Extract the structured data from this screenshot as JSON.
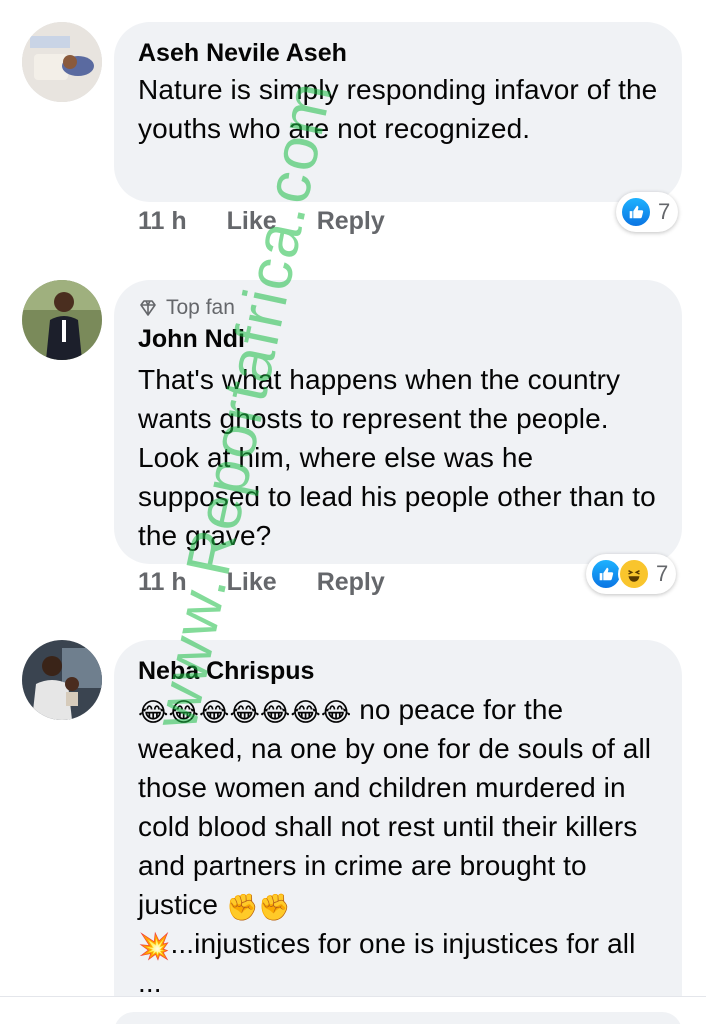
{
  "comments": [
    {
      "author": "Aseh Nevile Aseh",
      "badge": "",
      "text": "Nature is simply responding infavor of the youths who are not recognized.",
      "time": "11 h",
      "like_label": "Like",
      "reply_label": "Reply",
      "reactions": [
        "like"
      ],
      "reaction_count": "7"
    },
    {
      "author": "John Ndi",
      "badge": "Top fan",
      "text": "That's what happens when the country wants ghosts to represent the people. Look at him, where else was he supposed to lead his people other than to the grave?",
      "time": "11 h",
      "like_label": "Like",
      "reply_label": "Reply",
      "reactions": [
        "like",
        "haha"
      ],
      "reaction_count": "7"
    },
    {
      "author": "Neba Chrispus",
      "badge": "",
      "emoji_prefix": "😂😂😂😂😂😂😂",
      "text_part1": " no peace for the weaked, na one by one   for de souls of all those women and children murdered in cold blood shall not rest until their killers and partners in crime are brought to justice ",
      "emoji_mid": "✊✊",
      "emoji_burst": "💥",
      "text_part2": "...injustices for one is injustices for all ..."
    }
  ],
  "watermark": "www.Reportafrica.com",
  "colors": {
    "bubble": "#f0f2f5",
    "secondary_text": "#65676b",
    "like_blue": "#1877f2",
    "haha_yellow": "#f9c52d"
  }
}
